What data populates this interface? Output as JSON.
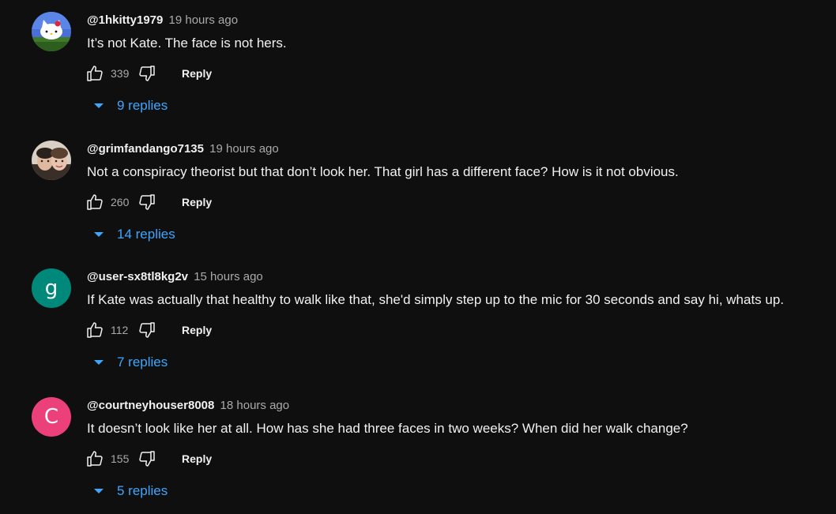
{
  "comments": [
    {
      "author": "@1hkitty1979",
      "time": "19 hours ago",
      "text": "It’s not Kate. The face is not hers.",
      "likes": "339",
      "reply_label": "Reply",
      "replies_label": "9 replies",
      "avatar_icon": "hello-kitty-avatar"
    },
    {
      "author": "@grimfandango7135",
      "time": "19 hours ago",
      "text": "Not a conspiracy theorist but that don’t look her. That girl has a different face? How is it not obvious.",
      "likes": "260",
      "reply_label": "Reply",
      "replies_label": "14 replies",
      "avatar_icon": "photo-avatar"
    },
    {
      "author": "@user-sx8tl8kg2v",
      "time": "15 hours ago",
      "text": "If Kate was actually that healthy to walk like that,  she'd simply step up to the mic for 30 seconds and say hi, whats up.",
      "likes": "112",
      "reply_label": "Reply",
      "replies_label": "7 replies",
      "avatar_letter": "g",
      "avatar_color": "#00897b"
    },
    {
      "author": "@courtneyhouser8008",
      "time": "18 hours ago",
      "text": "It doesn’t look like her at all. How has she had three faces in two weeks? When did her walk change?",
      "likes": "155",
      "reply_label": "Reply",
      "replies_label": "5 replies",
      "avatar_letter": "C",
      "avatar_color": "#ec407a"
    }
  ],
  "colors": {
    "background": "#0f0f0f",
    "text": "#f1f1f1",
    "secondary": "#aaaaaa",
    "link": "#3ea6ff"
  }
}
